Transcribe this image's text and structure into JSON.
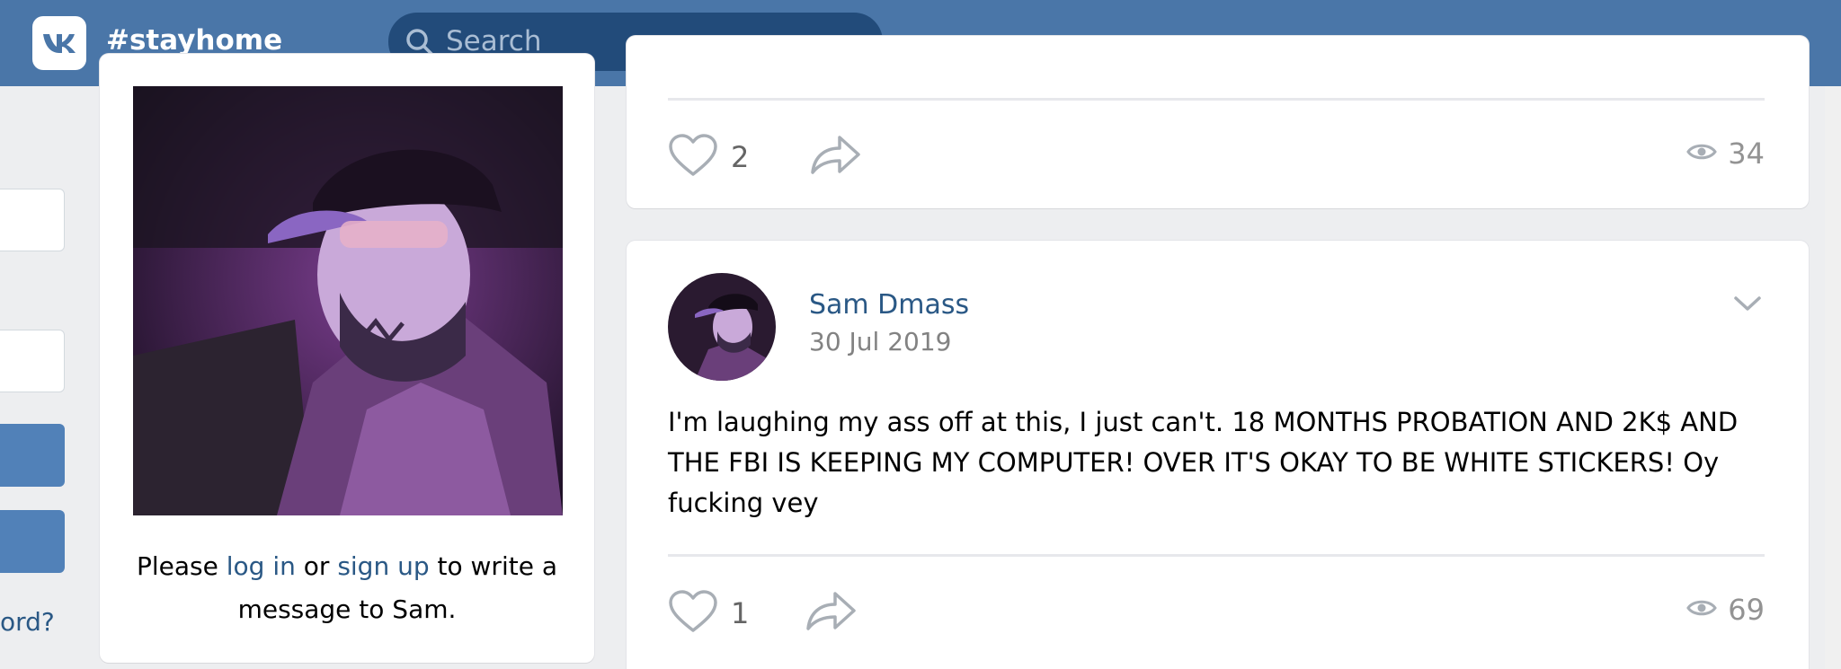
{
  "header": {
    "brand": "#stayhome",
    "search_placeholder": "Search"
  },
  "sidebar": {
    "forgot_fragment": "ord?"
  },
  "profile": {
    "message_prefix": "Please ",
    "login_link": "log in",
    "or_text": " or ",
    "signup_link": "sign up",
    "message_suffix": " to write a message to Sam."
  },
  "posts": [
    {
      "likes": "2",
      "views": "34"
    },
    {
      "author": "Sam Dmass",
      "date": "30 Jul 2019",
      "text": "I'm laughing my ass off at this, I just can't. 18 MONTHS PROBATION AND 2K$ AND THE FBI IS KEEPING MY COMPUTER! OVER IT'S OKAY TO BE WHITE STICKERS! Oy fucking vey",
      "likes": "1",
      "views": "69"
    }
  ],
  "icons": {
    "logo": "vk-logo-icon",
    "search": "search-icon",
    "like": "heart-icon",
    "share": "share-arrow-icon",
    "views": "eye-icon",
    "menu": "chevron-down-icon"
  },
  "colors": {
    "header": "#4a76a8",
    "link": "#2a5885",
    "background": "#edeef0"
  }
}
